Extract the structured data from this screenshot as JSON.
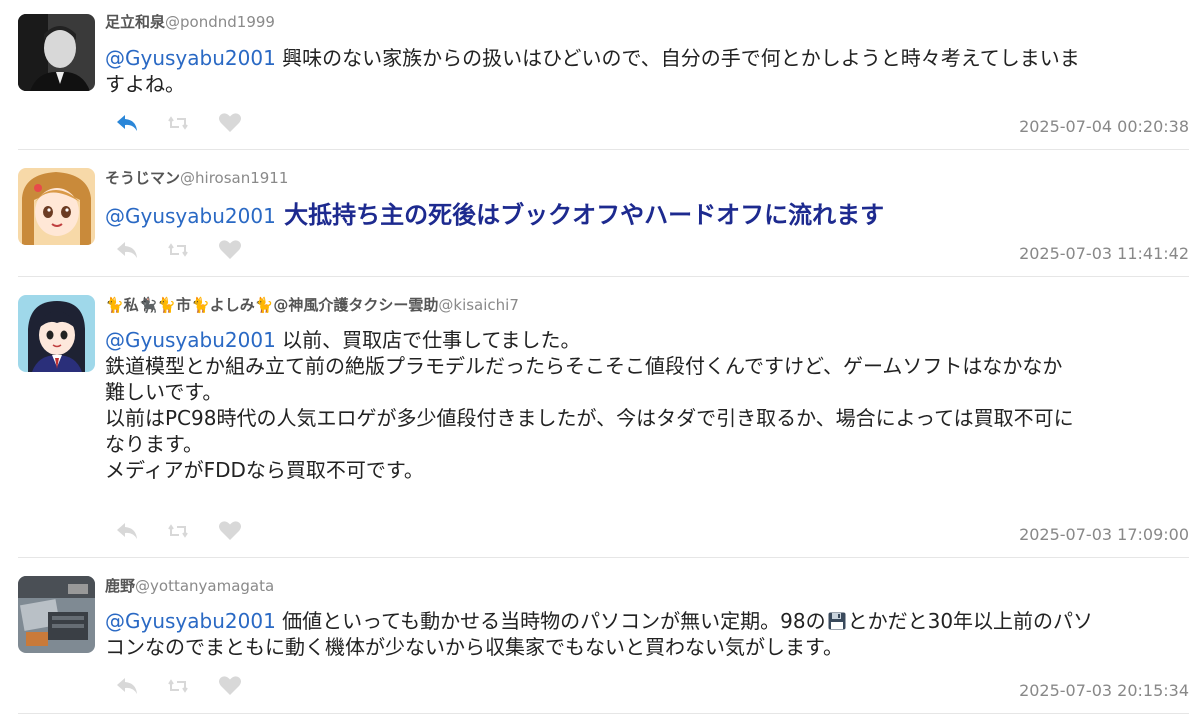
{
  "colors": {
    "mention": "#2a69c4",
    "emphasis": "#1d2a8f",
    "reply_active": "#2a86d8",
    "action_inactive": "#d8d8d8"
  },
  "tweets": [
    {
      "display_name": "足立和泉",
      "handle": "@pondnd1999",
      "mention": "@Gyusyabu2001",
      "lines": [
        "興味のない家族からの扱いはひどいので、自分の手で何とかしようと時々考えてしまいま",
        "すよね。"
      ],
      "timestamp": "2025-07-04 00:20:38",
      "actions": {
        "reply_icon": "reply-icon",
        "retweet_icon": "retweet-icon",
        "like_icon": "heart-icon",
        "reply_active": true
      }
    },
    {
      "display_name": "そうじマン",
      "handle": "@hirosan1911",
      "mention": "@Gyusyabu2001",
      "lines": [
        "大抵持ち主の死後はブックオフやハードオフに流れます"
      ],
      "timestamp": "2025-07-03 11:41:42"
    },
    {
      "display_name": "🐈私🐈‍⬛🐈市🐈よしみ🐈@神風介護タクシー雲助",
      "handle": "@kisaichi7",
      "mention": "@Gyusyabu2001",
      "lines": [
        "以前、買取店で仕事してました。",
        "鉄道模型とか組み立て前の絶版プラモデルだったらそこそこ値段付くんですけど、ゲームソフトはなかなか",
        "難しいです。",
        "以前はPC98時代の人気エロゲが多少値段付きましたが、今はタダで引き取るか、場合によっては買取不可に",
        "なります。",
        "メディアがFDDなら買取不可です。"
      ],
      "timestamp": "2025-07-03 17:09:00"
    },
    {
      "display_name": "鹿野",
      "handle": "@yottanyamagata",
      "mention": "@Gyusyabu2001",
      "line1_before_icon": "価値といっても動かせる当時物のパソコンが無い定期。98の",
      "line1_icon": "floppy-disk-icon",
      "line1_after_icon": "とかだと30年以上前のパソ",
      "line2": "コンなのでまともに動く機体が少ないから収集家でもないと買わない気がします。",
      "timestamp": "2025-07-03 20:15:34"
    }
  ]
}
